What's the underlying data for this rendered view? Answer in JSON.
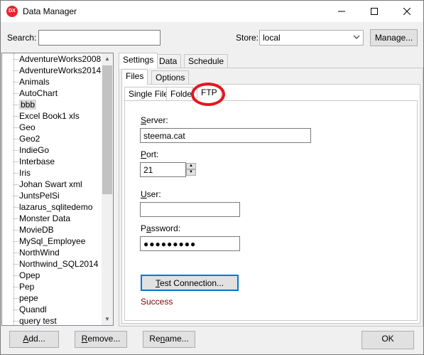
{
  "window": {
    "title": "Data Manager",
    "app_icon": "dx-logo-icon",
    "controls": [
      "minimize-icon",
      "maximize-icon",
      "close-icon"
    ]
  },
  "top_bar": {
    "search_label": "Search:",
    "search_value": "",
    "store_label": "Store:",
    "store_value": "local",
    "manage_button": "Manage..."
  },
  "sources": {
    "selected": "bbb",
    "items": [
      "AdventureWorks2008",
      "AdventureWorks2014",
      "Animals",
      "AutoChart",
      "bbb",
      "Excel Book1 xls",
      "Geo",
      "Geo2",
      "IndieGo",
      "Interbase",
      "Iris",
      "Johan Swart xml",
      "JuntsPelSi",
      "lazarus_sqlitedemo",
      "Monster Data",
      "MovieDB",
      "MySql_Employee",
      "NorthWind",
      "Northwind_SQL2014",
      "Opep",
      "Pep",
      "pepe",
      "Quandl",
      "query test"
    ]
  },
  "tabs": {
    "main": [
      "Settings",
      "Data",
      "Schedule"
    ],
    "main_active": "Settings",
    "sub": [
      "Files",
      "Options"
    ],
    "sub_active": "Files",
    "file": [
      "Single File",
      "Folder",
      "FTP"
    ],
    "file_active": "FTP"
  },
  "ftp": {
    "server_label": "Server:",
    "server_value": "steema.cat",
    "port_label": "Port:",
    "port_value": "21",
    "user_label": "User:",
    "user_value": "",
    "password_label": "Password:",
    "password_value": "●●●●●●●●●",
    "test_button": "Test Connection...",
    "status": "Success",
    "status_color": "#800000"
  },
  "bottom": {
    "add_button": "Add...",
    "remove_button": "Remove...",
    "rename_button": "Rename...",
    "ok_button": "OK"
  }
}
